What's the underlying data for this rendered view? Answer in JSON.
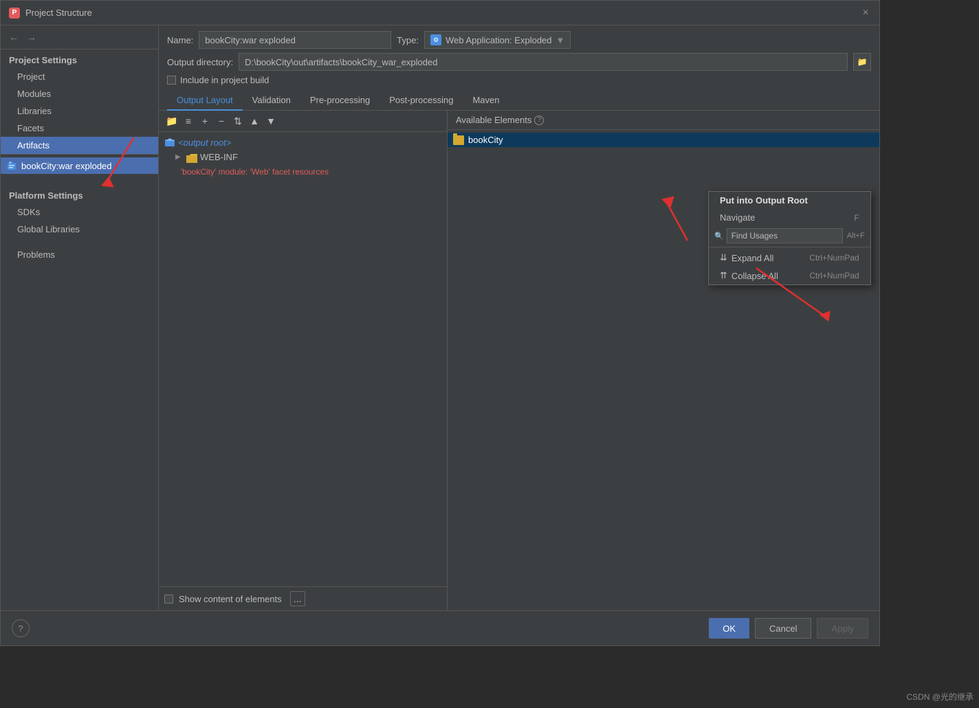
{
  "dialog": {
    "title": "Project Structure",
    "close_label": "×"
  },
  "sidebar": {
    "nav_back": "←",
    "nav_forward": "→",
    "project_settings_title": "Project Settings",
    "items": [
      {
        "id": "project",
        "label": "Project"
      },
      {
        "id": "modules",
        "label": "Modules"
      },
      {
        "id": "libraries",
        "label": "Libraries"
      },
      {
        "id": "facets",
        "label": "Facets"
      },
      {
        "id": "artifacts",
        "label": "Artifacts",
        "active": true
      }
    ],
    "platform_settings_title": "Platform Settings",
    "platform_items": [
      {
        "id": "sdks",
        "label": "SDKs"
      },
      {
        "id": "global-libraries",
        "label": "Global Libraries"
      }
    ],
    "other_items": [
      {
        "id": "problems",
        "label": "Problems"
      }
    ],
    "artifact_entry": "bookCity:war exploded"
  },
  "artifact_detail": {
    "name_label": "Name:",
    "name_value": "bookCity:war exploded",
    "type_label": "Type:",
    "type_value": "Web Application: Exploded",
    "output_dir_label": "Output directory:",
    "output_dir_value": "D:\\bookCity\\out\\artifacts\\bookCity_war_exploded",
    "include_build_label": "Include in project build",
    "include_build_checked": false
  },
  "tabs": [
    {
      "id": "output-layout",
      "label": "Output Layout",
      "active": true
    },
    {
      "id": "validation",
      "label": "Validation"
    },
    {
      "id": "pre-processing",
      "label": "Pre-processing"
    },
    {
      "id": "post-processing",
      "label": "Post-processing"
    },
    {
      "id": "maven",
      "label": "Maven"
    }
  ],
  "left_panel": {
    "toolbar_buttons": [
      "+",
      "−",
      "📁",
      "▼",
      "▲",
      "▼▼"
    ],
    "tree_items": [
      {
        "id": "output-root",
        "label": "<output root>",
        "type": "root",
        "indent": 0
      },
      {
        "id": "web-inf",
        "label": "WEB-INF",
        "type": "folder",
        "indent": 1,
        "expanded": false
      },
      {
        "id": "error-item",
        "label": "'bookCity' module: 'Web' facet resources",
        "type": "error",
        "indent": 1
      }
    ],
    "footer": {
      "show_content_label": "Show content of elements",
      "show_content_checked": false,
      "btn_label": "..."
    }
  },
  "right_panel": {
    "available_elements_label": "Available Elements",
    "selected_item": "bookCity",
    "items": [
      {
        "id": "bookcity",
        "label": "bookCity",
        "selected": true
      }
    ]
  },
  "context_menu": {
    "items": [
      {
        "id": "put-into-output-root",
        "label": "Put into Output Root",
        "shortcut": "",
        "bold": true
      },
      {
        "id": "navigate",
        "label": "Navigate",
        "shortcut": "F"
      },
      {
        "id": "find-usages",
        "label": "Find Usages",
        "shortcut": "Alt+F",
        "type": "search"
      },
      {
        "id": "expand-all",
        "label": "Expand All",
        "shortcut": "Ctrl+NumPad"
      },
      {
        "id": "collapse-all",
        "label": "Collapse All",
        "shortcut": "Ctrl+NumPad"
      }
    ],
    "find_placeholder": "Find Usages"
  },
  "footer_buttons": {
    "ok_label": "OK",
    "cancel_label": "Cancel",
    "apply_label": "Apply"
  },
  "watermark": "CSDN @光的继承"
}
